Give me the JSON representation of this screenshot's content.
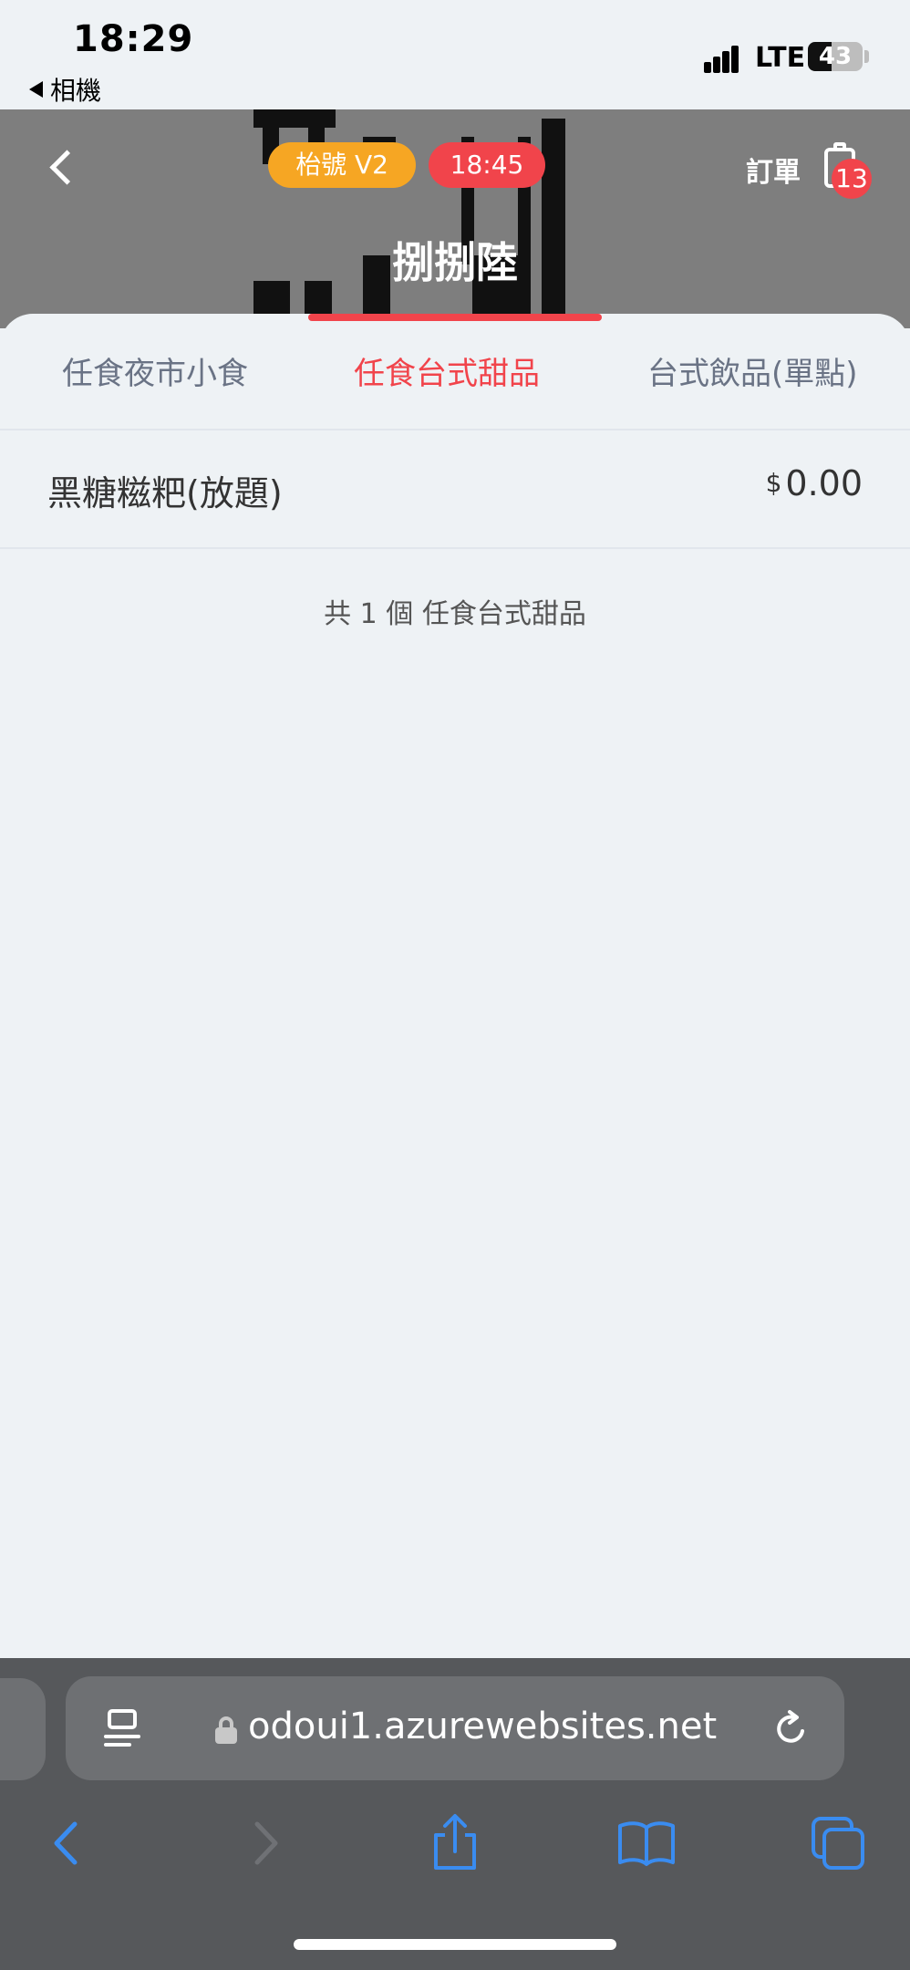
{
  "status_bar": {
    "time": "18:29",
    "back_app_label": "相機",
    "network": "LTE",
    "battery": "43",
    "battery_level": 0.43
  },
  "header": {
    "table_label": "枱號 V2",
    "time_label": "18:45",
    "orders_label": "訂單",
    "orders_badge": "13",
    "store_title": "捌捌陸"
  },
  "tabs": [
    {
      "label": "任食夜市小食",
      "active": false
    },
    {
      "label": "任食台式甜品",
      "active": true
    },
    {
      "label": "台式飲品(單點)",
      "active": false
    }
  ],
  "items": [
    {
      "name": "黑糖糍粑(放題)",
      "currency": "$",
      "price": "0.00"
    }
  ],
  "summary": "共 1 個 任食台式甜品",
  "browser": {
    "url": "odoui1.azurewebsites.net"
  },
  "colors": {
    "accent_red": "#f1444b",
    "table_pill": "#f6a623",
    "header_bg": "#7e7e7e",
    "browser_chrome": "#56585b",
    "toolbar_blue": "#3a8cf0"
  },
  "icons": {
    "back": "chevron-left-icon",
    "orders": "clipboard-icon",
    "reader": "reader-icon",
    "lock": "lock-icon",
    "reload": "reload-icon",
    "toolbar": [
      "chevron-left-icon",
      "chevron-right-icon",
      "share-icon",
      "bookmarks-icon",
      "tabs-icon"
    ]
  }
}
